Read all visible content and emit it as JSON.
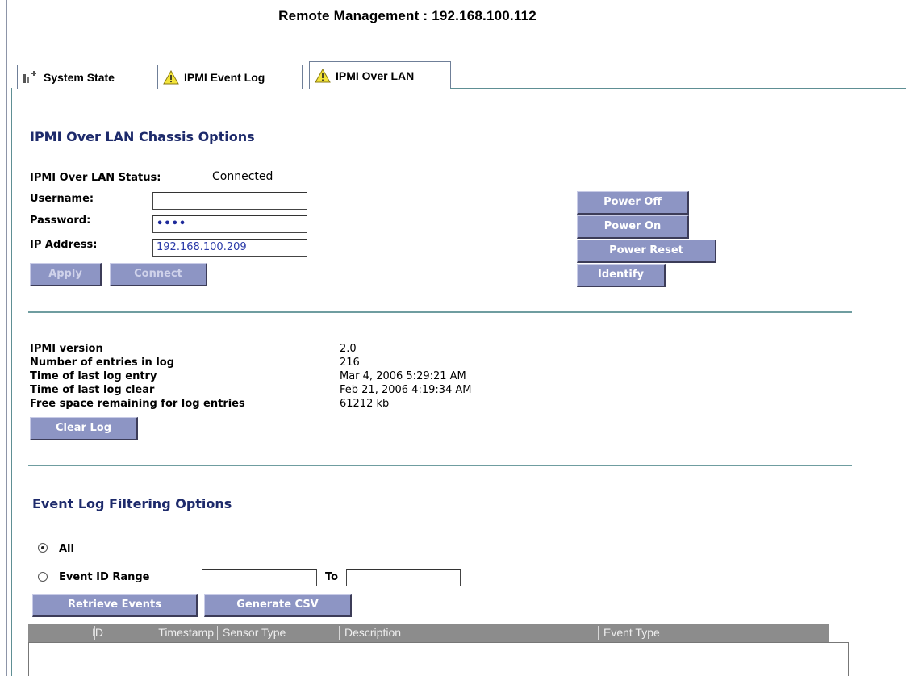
{
  "page_title": "Remote Management : 192.168.100.112",
  "tabs": [
    {
      "label": "System State",
      "icon": "system-state-icon"
    },
    {
      "label": "IPMI Event Log",
      "icon": "warning-icon"
    },
    {
      "label": "IPMI Over LAN",
      "icon": "warning-icon",
      "active": true
    }
  ],
  "chassis": {
    "heading": "IPMI Over LAN Chassis Options",
    "status_label": "IPMI Over LAN Status:",
    "status_value": "Connected",
    "username_label": "Username:",
    "username_value": "",
    "password_label": "Password:",
    "password_value": "••••",
    "ip_label": "IP Address:",
    "ip_value": "192.168.100.209",
    "apply_label": "Apply",
    "connect_label": "Connect",
    "power_off_label": "Power Off",
    "power_on_label": "Power On",
    "power_reset_label": "Power Reset",
    "identify_label": "Identify"
  },
  "log_info": {
    "rows": [
      {
        "label": "IPMI version",
        "value": "2.0"
      },
      {
        "label": "Number of entries in log",
        "value": "216"
      },
      {
        "label": "Time of last log entry",
        "value": "Mar 4, 2006 5:29:21 AM"
      },
      {
        "label": "Time of last log clear",
        "value": "Feb 21, 2006 4:19:34 AM"
      },
      {
        "label": "Free space remaining for log entries",
        "value": "61212 kb"
      }
    ],
    "clear_log_label": "Clear Log"
  },
  "filter": {
    "heading": "Event Log Filtering Options",
    "all_label": "All",
    "range_label": "Event ID Range",
    "to_label": "To",
    "from_value": "",
    "to_value": "",
    "retrieve_label": "Retrieve Events",
    "csv_label": "Generate CSV"
  },
  "table": {
    "columns": [
      "ID",
      "Timestamp",
      "Sensor Type",
      "Description",
      "Event Type"
    ]
  },
  "colors": {
    "button": "#8d95c4",
    "heading": "#1d2a6b",
    "separator": "#6f9da0",
    "table_header": "#8c8c8c"
  }
}
